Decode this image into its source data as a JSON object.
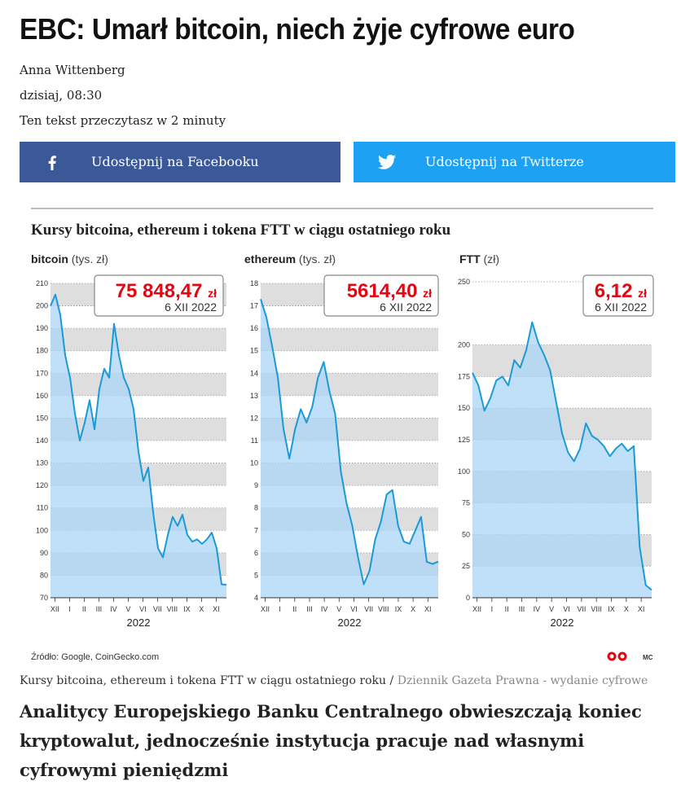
{
  "article": {
    "title": "EBC: Umarł bitcoin, niech żyje cyfrowe euro",
    "author": "Anna Wittenberg",
    "date": "dzisiaj, 08:30",
    "reading_time": "Ten tekst przeczytasz w 2 minuty",
    "share_facebook": "Udostępnij na Facebooku",
    "share_twitter": "Udostępnij na Twitterze",
    "figure_caption": "Kursy bitcoina, ethereum i tokena FTT w ciągu ostatniego roku",
    "figure_caption_sep": " / ",
    "figure_source": "Dziennik Gazeta Prawna - wydanie cyfrowe",
    "lead": "Analitycy Europejskiego Banku Centralnego obwieszczają koniec kryptowalut, jednocześnie instytucja pracuje nad własnymi cyfrowymi pieniędzmi"
  },
  "figure": {
    "title": "Kursy bitcoina, ethereum i tokena FTT w ciągu ostatniego roku",
    "source": "Źródło: Google, CoinGecko.com",
    "logo_text": "MC",
    "accent": "#e30613",
    "line_color": "#1a9ad6"
  },
  "chart_data": [
    {
      "type": "line",
      "name": "bitcoin",
      "unit": "(tys. zł)",
      "value_label": "75 848,47",
      "value_unit": "zł",
      "value_date": "6 XII 2022",
      "ylim": [
        70,
        210
      ],
      "yticks": [
        70,
        80,
        90,
        100,
        110,
        120,
        130,
        140,
        150,
        160,
        170,
        180,
        190,
        200,
        210
      ],
      "x_ticks": [
        "XII",
        "I",
        "II",
        "III",
        "IV",
        "V",
        "VI",
        "VII",
        "VIII",
        "IX",
        "X",
        "XI"
      ],
      "year": "2022",
      "series": [
        {
          "values": [
            200,
            205,
            196,
            178,
            168,
            152,
            140,
            148,
            158,
            145,
            163,
            172,
            168,
            192,
            178,
            168,
            163,
            154,
            135,
            122,
            128,
            108,
            92,
            88,
            98,
            106,
            102,
            107,
            98,
            95,
            96,
            94,
            96,
            99,
            92,
            76,
            75.8
          ]
        }
      ]
    },
    {
      "type": "line",
      "name": "ethereum",
      "unit": "(tys. zł)",
      "value_label": "5614,40",
      "value_unit": "zł",
      "value_date": "6 XII 2022",
      "ylim": [
        4,
        18
      ],
      "yticks": [
        4,
        5,
        6,
        7,
        8,
        9,
        10,
        11,
        12,
        13,
        14,
        15,
        16,
        17,
        18
      ],
      "x_ticks": [
        "XII",
        "I",
        "II",
        "III",
        "IV",
        "V",
        "VI",
        "VII",
        "VIII",
        "IX",
        "X",
        "XI"
      ],
      "year": "2022",
      "series": [
        {
          "values": [
            17.3,
            16.5,
            15.2,
            13.8,
            11.5,
            10.2,
            11.5,
            12.4,
            11.8,
            12.5,
            13.8,
            14.5,
            13.2,
            12.2,
            9.6,
            8.2,
            7.2,
            5.8,
            4.6,
            5.2,
            6.6,
            7.4,
            8.6,
            8.8,
            7.2,
            6.5,
            6.4,
            7.0,
            7.6,
            5.6,
            5.5,
            5.61
          ]
        }
      ]
    },
    {
      "type": "line",
      "name": "FTT",
      "unit": "(zł)",
      "value_label": "6,12",
      "value_unit": "zł",
      "value_date": "6 XII 2022",
      "ylim": [
        0,
        250
      ],
      "yticks": [
        0,
        25,
        50,
        75,
        100,
        125,
        150,
        175,
        200,
        250
      ],
      "x_ticks": [
        "XII",
        "I",
        "II",
        "III",
        "IV",
        "V",
        "VI",
        "VII",
        "VIII",
        "IX",
        "X",
        "XI"
      ],
      "year": "2022",
      "series": [
        {
          "values": [
            178,
            168,
            148,
            158,
            172,
            175,
            168,
            188,
            182,
            196,
            218,
            202,
            192,
            180,
            155,
            130,
            115,
            108,
            118,
            138,
            128,
            125,
            120,
            112,
            118,
            122,
            116,
            120,
            40,
            10,
            6.12
          ]
        }
      ]
    }
  ],
  "icons": {
    "facebook": "facebook-icon",
    "twitter": "twitter-icon",
    "logo": "publisher-logo-icon"
  },
  "colors": {
    "facebook": "#3b5998",
    "twitter": "#1da1f2",
    "chart_fill": "#a9d6f5",
    "band": "#dedede"
  }
}
